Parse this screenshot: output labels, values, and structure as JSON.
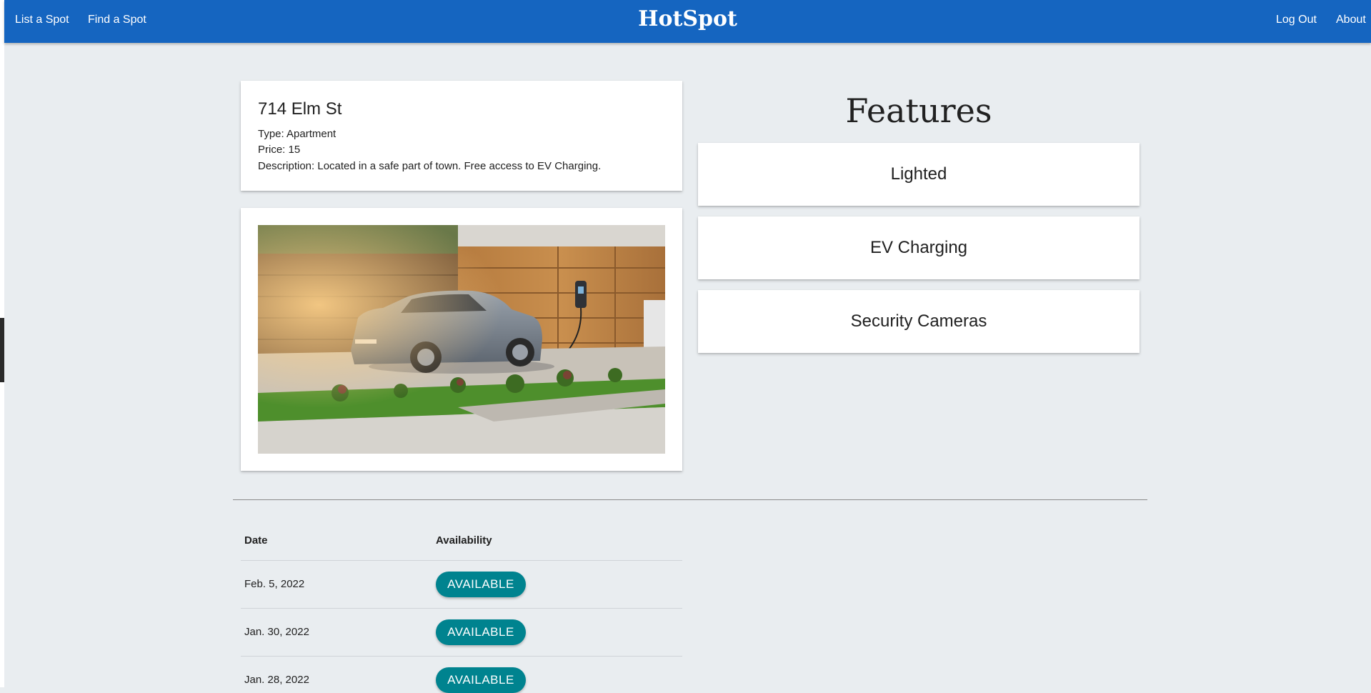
{
  "nav": {
    "brand": "HotSpot",
    "left_links": [
      "List a Spot",
      "Find a Spot"
    ],
    "right_links": [
      "Log Out",
      "About"
    ],
    "color": "#1565c0"
  },
  "spot": {
    "title": "714 Elm St",
    "type_line": "Type: Apartment",
    "price_line": "Price: 15",
    "description_line": "Description: Located in a safe part of town. Free access to EV Charging.",
    "photo_alt": "electric car parked in driveway"
  },
  "features": {
    "heading": "Features",
    "items": [
      "Lighted",
      "EV Charging",
      "Security Cameras"
    ]
  },
  "availability": {
    "headers": [
      "Date",
      "Availability"
    ],
    "rows": [
      {
        "date": "Feb. 5, 2022",
        "status": "AVAILABLE"
      },
      {
        "date": "Jan. 30, 2022",
        "status": "AVAILABLE"
      },
      {
        "date": "Jan. 28, 2022",
        "status": "AVAILABLE"
      }
    ],
    "badge_color": "#00838f"
  }
}
